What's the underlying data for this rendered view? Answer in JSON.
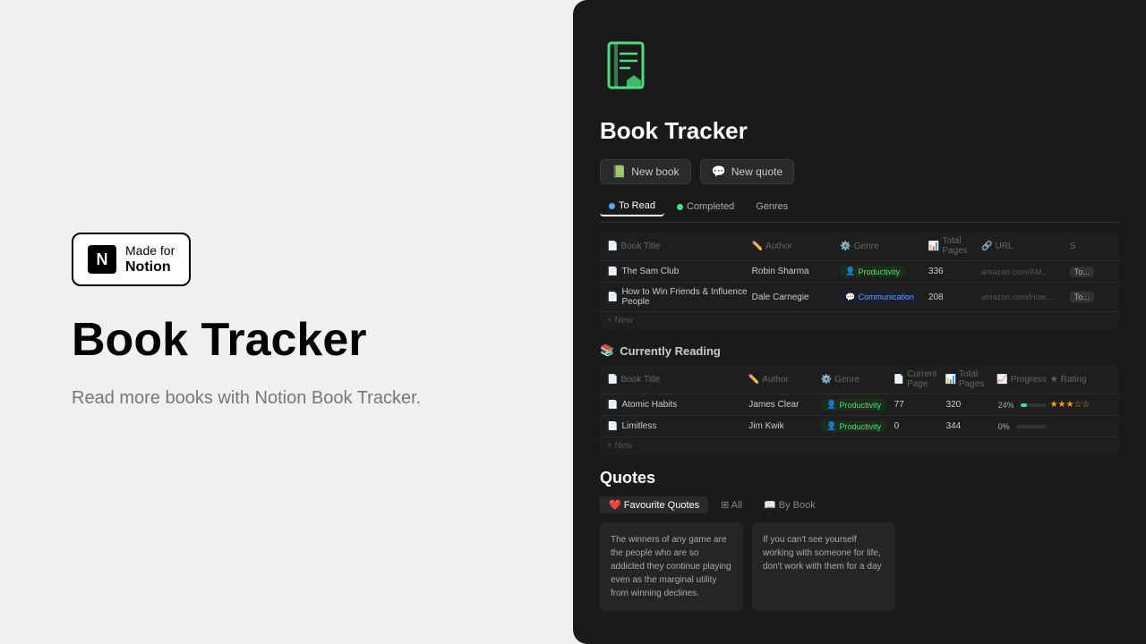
{
  "left": {
    "badge": {
      "made_for": "Made for",
      "notion": "Notion"
    },
    "title": "Book Tracker",
    "description": "Read more books with Notion Book Tracker."
  },
  "right": {
    "app_title": "Book Tracker",
    "buttons": [
      {
        "label": "New book",
        "icon": "📗"
      },
      {
        "label": "New quote",
        "icon": "💬"
      }
    ],
    "tabs_to_read": [
      {
        "label": "To Read",
        "active": true
      },
      {
        "label": "Completed",
        "active": false
      },
      {
        "label": "Genres",
        "active": false
      }
    ],
    "to_read_columns": [
      "Book Title",
      "Author",
      "Genre",
      "Total Pages",
      "URL",
      "S"
    ],
    "to_read_rows": [
      {
        "title": "The Sam Club",
        "author": "Robin Sharma",
        "genre": "Productivity",
        "genre_type": "productivity",
        "pages": "336",
        "url": "amazon.com/AM...",
        "status": "To..."
      },
      {
        "title": "How to Win Friends & Influence People",
        "author": "Dale Carnegie",
        "genre": "Communication",
        "genre_type": "communication",
        "pages": "208",
        "url": "amazon.com/How...",
        "status": "To..."
      }
    ],
    "currently_reading_label": "Currently Reading",
    "currently_reading_columns": [
      "Book Title",
      "Author",
      "Genre",
      "Current Page",
      "Total Pages",
      "Progress",
      "Rating"
    ],
    "currently_reading_rows": [
      {
        "title": "Atomic Habits",
        "author": "James Clear",
        "genre": "Productivity",
        "genre_type": "productivity",
        "current_page": "77",
        "total_pages": "320",
        "progress": "24%",
        "progress_pct": 24,
        "rating": "★★★☆☆"
      },
      {
        "title": "Limitless",
        "author": "Jim Kwik",
        "genre": "Productivity",
        "genre_type": "productivity",
        "current_page": "0",
        "total_pages": "344",
        "progress": "0%",
        "progress_pct": 0,
        "rating": ""
      }
    ],
    "quotes_title": "Quotes",
    "quotes_tabs": [
      {
        "label": "❤️ Favourite Quotes",
        "active": true
      },
      {
        "label": "⊞ All",
        "active": false
      },
      {
        "label": "📖 By Book",
        "active": false
      }
    ],
    "quote_cards": [
      {
        "text": "The winners of any game are the people who are so addicted they continue playing even as the marginal utility from winning declines."
      },
      {
        "text": "If you can't see yourself working with someone for life, don't work with them for a day"
      }
    ]
  }
}
